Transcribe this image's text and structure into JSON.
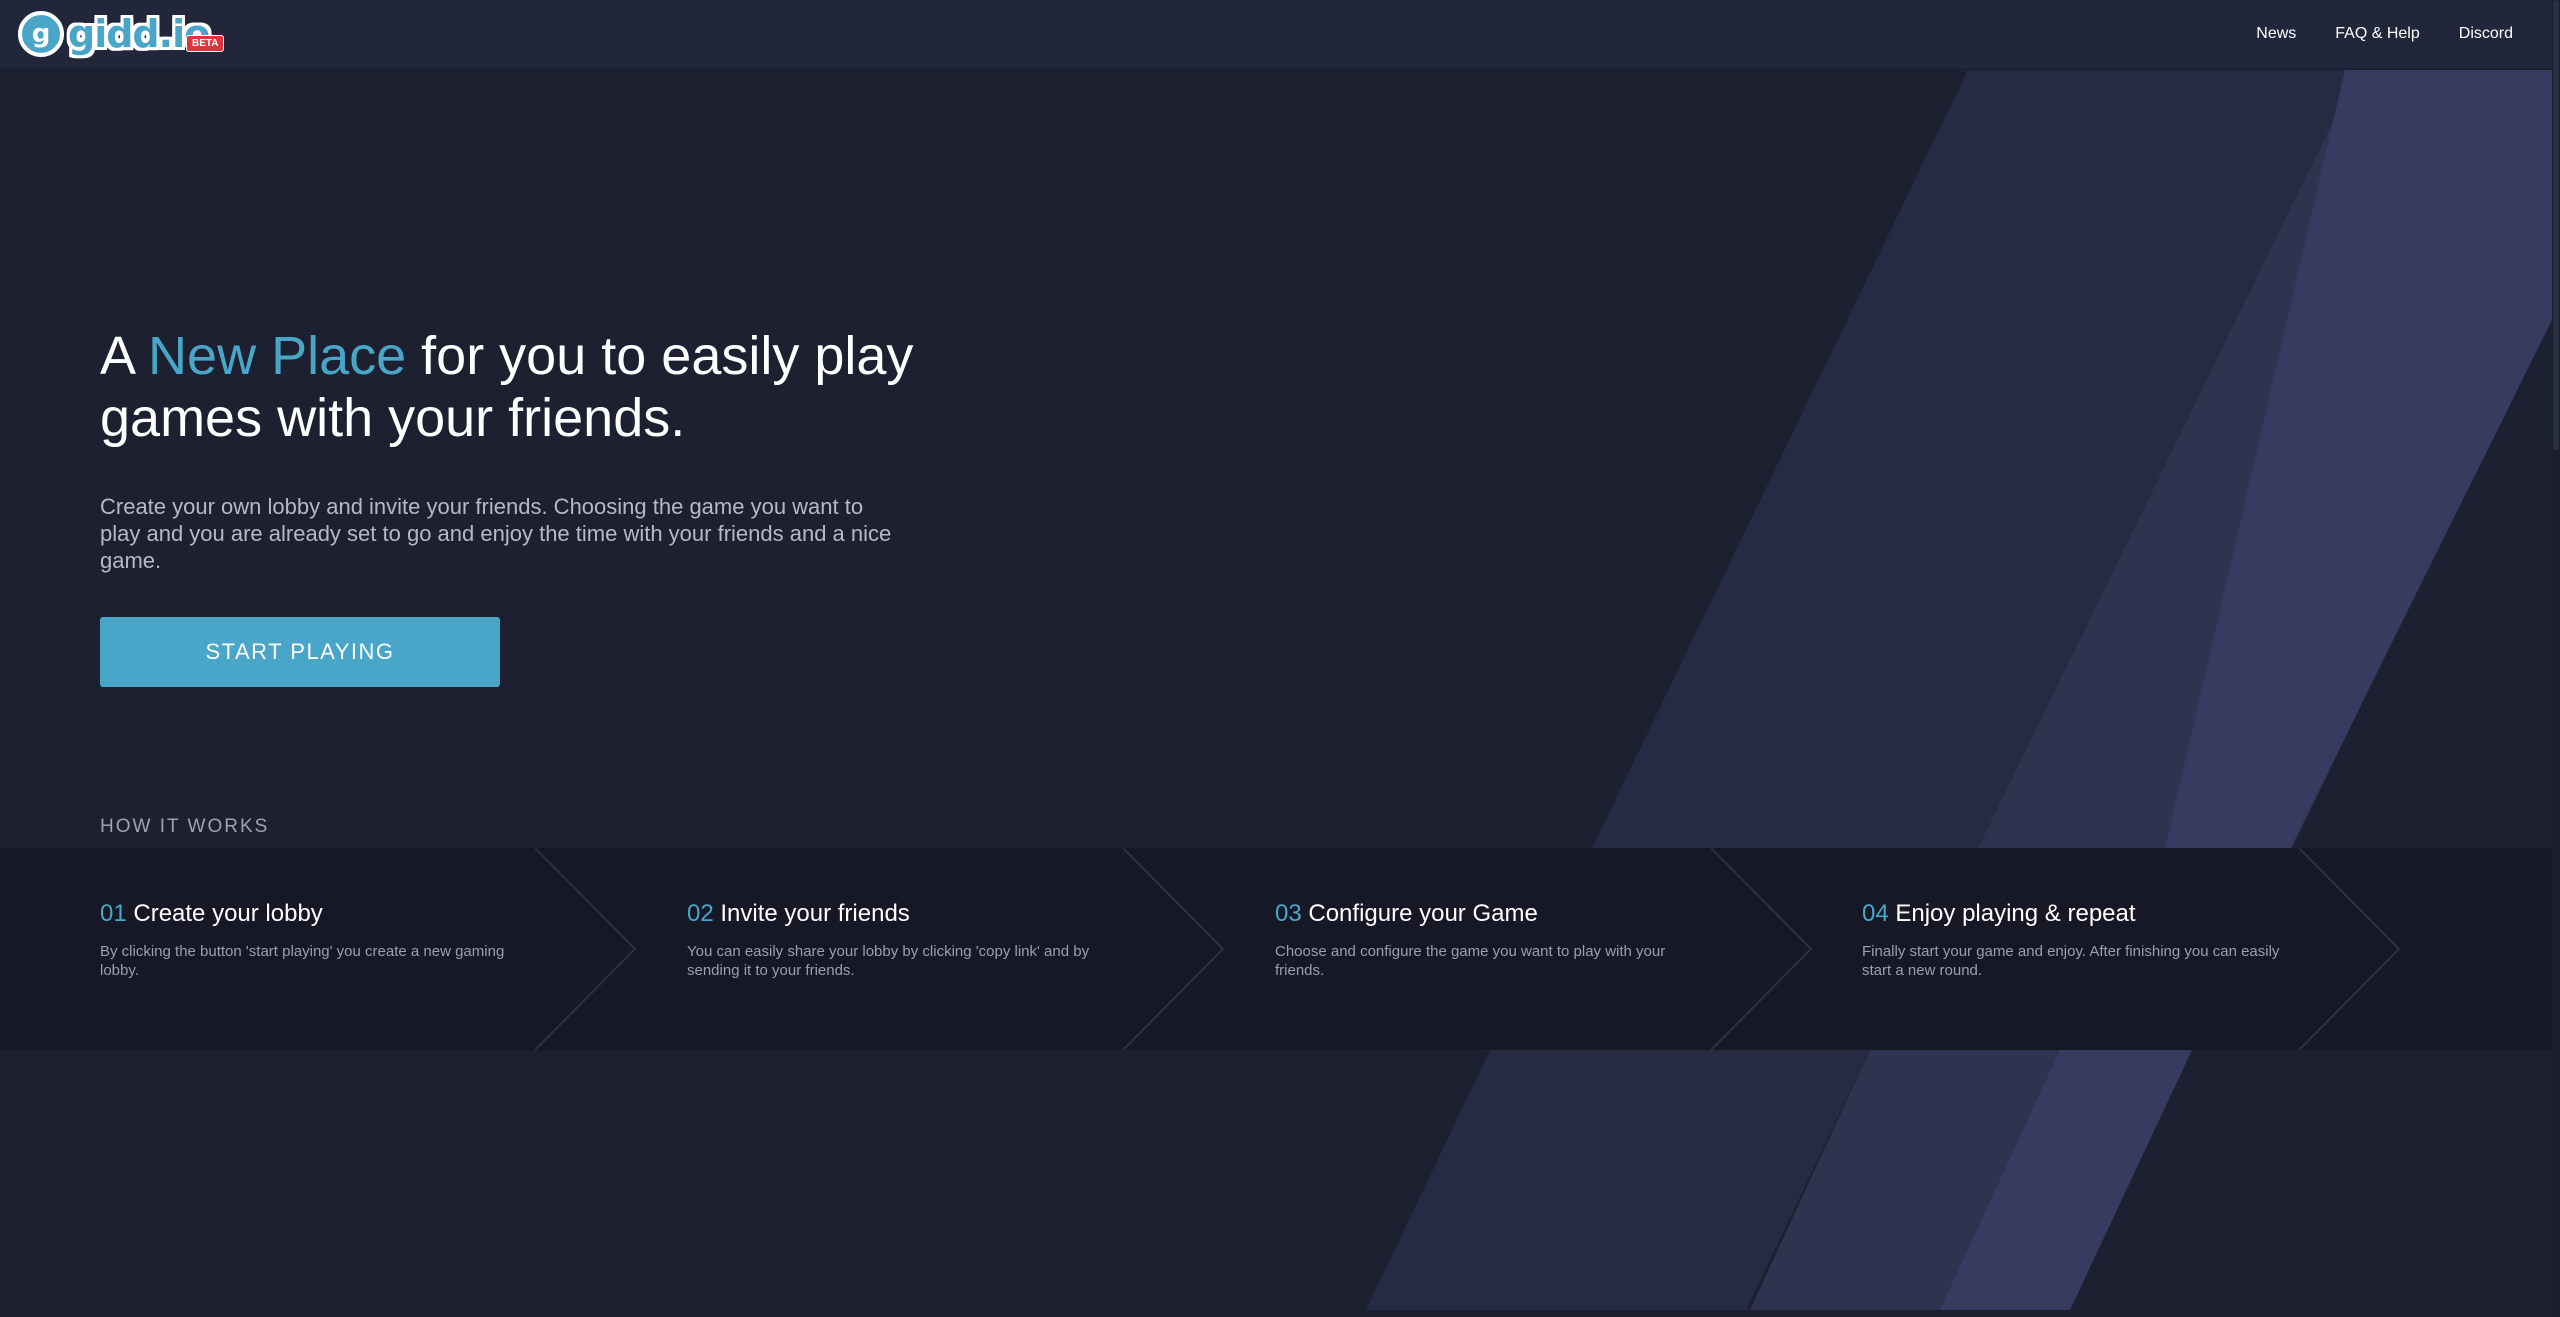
{
  "header": {
    "logo_text": "gidd.io",
    "logo_mark": "g",
    "beta_label": "BETA",
    "nav": [
      "News",
      "FAQ & Help",
      "Discord"
    ]
  },
  "hero": {
    "title_prefix": "A ",
    "title_accent": "New Place",
    "title_suffix": " for you to easily play games with your friends.",
    "description": "Create your own lobby and invite your friends. Choosing the game you want to play and you are already set to go and enjoy the time with your friends and a nice game.",
    "cta_label": "START PLAYING"
  },
  "how_it_works": {
    "title": "HOW IT WORKS",
    "steps": [
      {
        "num": "01",
        "title": " Create your lobby",
        "text": "By clicking the button 'start playing' you create a new gaming lobby."
      },
      {
        "num": "02",
        "title": " Invite your friends",
        "text": "You can easily share your lobby by clicking 'copy link' and by sending it to your friends."
      },
      {
        "num": "03",
        "title": " Configure your Game",
        "text": "Choose and configure the game you want to play with your friends."
      },
      {
        "num": "04",
        "title": " Enjoy playing & repeat",
        "text": "Finally start your game and enjoy. After finishing you can easily start a new round."
      }
    ]
  },
  "colors": {
    "background": "#1d2030",
    "header": "#22263a",
    "accent": "#4aa6c9",
    "steps_band": "#161925",
    "stripe_dark": "#262a42",
    "stripe_light": "#363c5f",
    "beta_badge": "#e0343c"
  }
}
